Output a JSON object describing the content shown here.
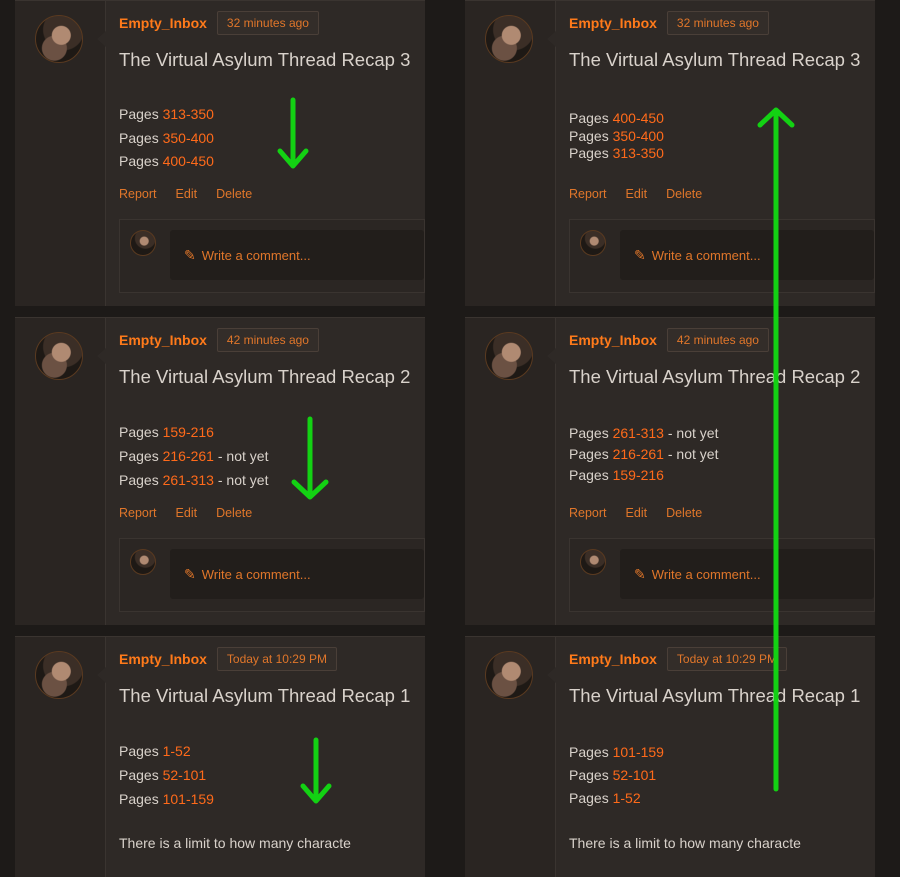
{
  "left": {
    "cards": [
      {
        "username": "Empty_Inbox",
        "time": "32 minutes ago",
        "title": "The Virtual Asylum Thread Recap 3",
        "lines": [
          {
            "prefix": "Pages ",
            "range": "313-350",
            "suffix": ""
          },
          {
            "prefix": "Pages ",
            "range": "350-400",
            "suffix": ""
          },
          {
            "prefix": "Pages ",
            "range": "400-450",
            "suffix": ""
          }
        ],
        "actions": {
          "report": "Report",
          "edit": "Edit",
          "delete": "Delete"
        },
        "comment_placeholder": "Write a comment..."
      },
      {
        "username": "Empty_Inbox",
        "time": "42 minutes ago",
        "title": "The Virtual Asylum Thread Recap 2",
        "lines": [
          {
            "prefix": "Pages ",
            "range": "159-216",
            "suffix": ""
          },
          {
            "prefix": "Pages ",
            "range": "216-261",
            "suffix": " - not yet"
          },
          {
            "prefix": "Pages ",
            "range": "261-313",
            "suffix": " - not yet"
          }
        ],
        "actions": {
          "report": "Report",
          "edit": "Edit",
          "delete": "Delete"
        },
        "comment_placeholder": "Write a comment..."
      },
      {
        "username": "Empty_Inbox",
        "time": "Today at 10:29 PM",
        "title": "The Virtual Asylum Thread Recap 1",
        "lines": [
          {
            "prefix": "Pages ",
            "range": "1-52",
            "suffix": ""
          },
          {
            "prefix": "Pages ",
            "range": "52-101",
            "suffix": ""
          },
          {
            "prefix": "Pages ",
            "range": "101-159",
            "suffix": ""
          }
        ],
        "truncated_text": "There is a limit to how many characte"
      }
    ]
  },
  "right": {
    "cards": [
      {
        "username": "Empty_Inbox",
        "time": "32 minutes ago",
        "title": "The Virtual Asylum Thread Recap 3",
        "lines": [
          {
            "prefix": "Pages ",
            "range": "400-450",
            "suffix": ""
          },
          {
            "prefix": "Pages ",
            "range": "350-400",
            "suffix": ""
          },
          {
            "prefix": "Pages ",
            "range": "313-350",
            "suffix": ""
          }
        ],
        "actions": {
          "report": "Report",
          "edit": "Edit",
          "delete": "Delete"
        },
        "comment_placeholder": "Write a comment..."
      },
      {
        "username": "Empty_Inbox",
        "time": "42 minutes ago",
        "title": "The Virtual Asylum Thread Recap 2",
        "lines": [
          {
            "prefix": "Pages ",
            "range": "261-313",
            "suffix": " - not yet"
          },
          {
            "prefix": "Pages ",
            "range": "216-261",
            "suffix": " - not yet"
          },
          {
            "prefix": "Pages ",
            "range": "159-216",
            "suffix": ""
          }
        ],
        "actions": {
          "report": "Report",
          "edit": "Edit",
          "delete": "Delete"
        },
        "comment_placeholder": "Write a comment..."
      },
      {
        "username": "Empty_Inbox",
        "time": "Today at 10:29 PM",
        "title": "The Virtual Asylum Thread Recap 1",
        "lines": [
          {
            "prefix": "Pages ",
            "range": "101-159",
            "suffix": ""
          },
          {
            "prefix": "Pages ",
            "range": "52-101",
            "suffix": ""
          },
          {
            "prefix": "Pages ",
            "range": "1-52",
            "suffix": ""
          }
        ],
        "truncated_text": "There is a limit to how many characte"
      }
    ]
  },
  "annotation_arrows": {
    "color": "#13d113",
    "count_down": 3,
    "count_up": 1,
    "icons": [
      "arrow-down-icon",
      "arrow-up-icon"
    ]
  },
  "colors": {
    "accent": "#ff7a1a",
    "card_bg": "#2e2926",
    "page_bg": "#1d1a18"
  }
}
